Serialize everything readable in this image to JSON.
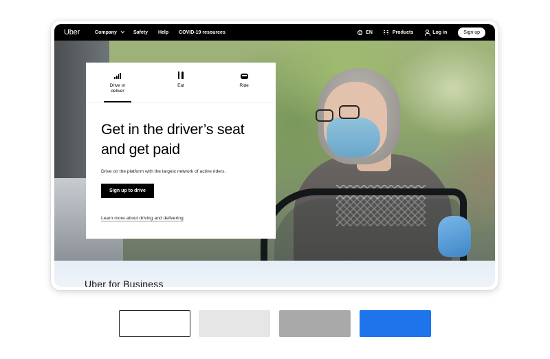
{
  "nav": {
    "logo": "Uber",
    "links": [
      "Company",
      "Safety",
      "Help",
      "COVID-19 resources"
    ],
    "language": "EN",
    "products": "Products",
    "login": "Log in",
    "signup": "Sign up"
  },
  "card": {
    "tabs": [
      {
        "label": "Drive or deliver",
        "icon": "bars-icon"
      },
      {
        "label": "Eat",
        "icon": "fork-knife-icon"
      },
      {
        "label": "Ride",
        "icon": "car-icon"
      }
    ],
    "headline": "Get in the driver’s seat and get paid",
    "subtitle": "Drive on the platform with the largest network of active riders.",
    "cta": "Sign up to drive",
    "learn_more": "Learn more about driving and delivering"
  },
  "section": {
    "title": "Uber for Business"
  },
  "swatches": {
    "colors": [
      "#ffffff",
      "#e6e6e6",
      "#a9a9a9",
      "#1e74ea"
    ]
  }
}
